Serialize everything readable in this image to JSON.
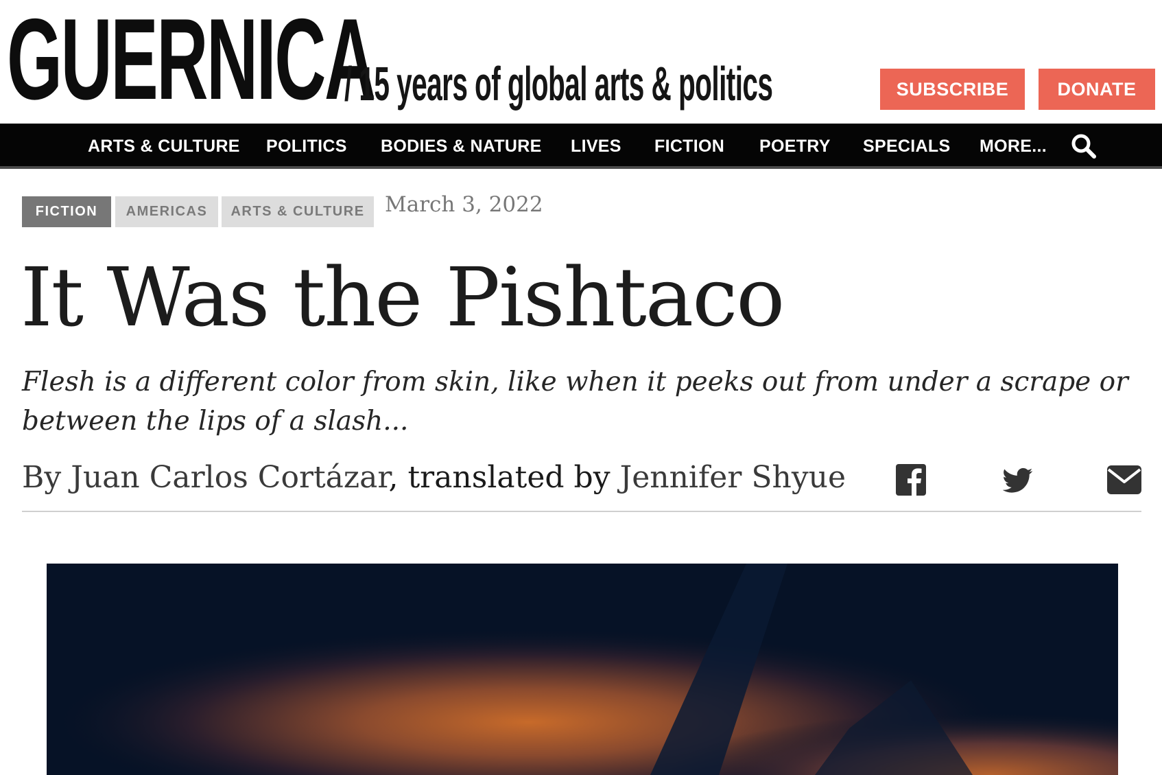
{
  "brand": {
    "logo": "GUERNICA",
    "tagline": "/ 15 years of global arts & politics"
  },
  "header_buttons": {
    "subscribe": "SUBSCRIBE",
    "donate": "DONATE",
    "accent_color": "#ec6655"
  },
  "nav": {
    "items": [
      "ARTS & CULTURE",
      "POLITICS",
      "BODIES & NATURE",
      "LIVES",
      "FICTION",
      "POETRY",
      "SPECIALS",
      "MORE..."
    ],
    "search_icon": "search-icon"
  },
  "article": {
    "tags": [
      "FICTION",
      "AMERICAS",
      "ARTS & CULTURE"
    ],
    "date": "March 3, 2022",
    "title": "It Was the Pishtaco",
    "dek": "Flesh is a different color from skin, like when it peeks out from under a scrape or between the lips of a slash...",
    "byline": {
      "prefix": "By",
      "author": "Juan Carlos Cortázar",
      "joiner": ", translated by",
      "translator": "Jennifer Shyue"
    },
    "share_icons": [
      "facebook-icon",
      "twitter-icon",
      "email-icon"
    ]
  }
}
